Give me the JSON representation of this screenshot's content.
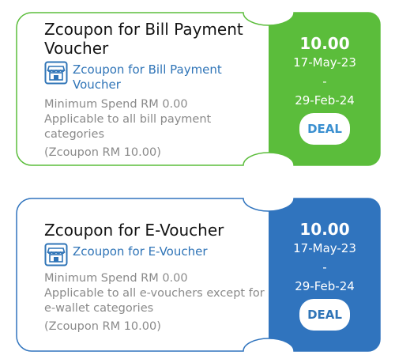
{
  "colors": {
    "green": "#5bbd3b",
    "blue": "#3074be",
    "link": "#2f74b7",
    "muted": "#8a8a8a"
  },
  "icons": {
    "brand": "shop-icon"
  },
  "vouchers": [
    {
      "title": "Zcoupon for Bill Payment Voucher",
      "brand": "Zcoupon for Bill Payment Voucher",
      "min_spend": "Minimum Spend RM 0.00",
      "applicable": "Applicable to all bill payment categories",
      "note": "(Zcoupon RM 10.00)",
      "amount": "10.00",
      "start_date": "17-May-23",
      "separator": "-",
      "end_date": "29-Feb-24",
      "deal_label": "DEAL"
    },
    {
      "title": "Zcoupon for E-Voucher",
      "brand": "Zcoupon for E-Voucher",
      "min_spend": "Minimum Spend RM 0.00",
      "applicable": "Applicable to all e-vouchers except for e-wallet categories",
      "note": "(Zcoupon RM 10.00)",
      "amount": "10.00",
      "start_date": "17-May-23",
      "separator": "-",
      "end_date": "29-Feb-24",
      "deal_label": "DEAL"
    }
  ]
}
